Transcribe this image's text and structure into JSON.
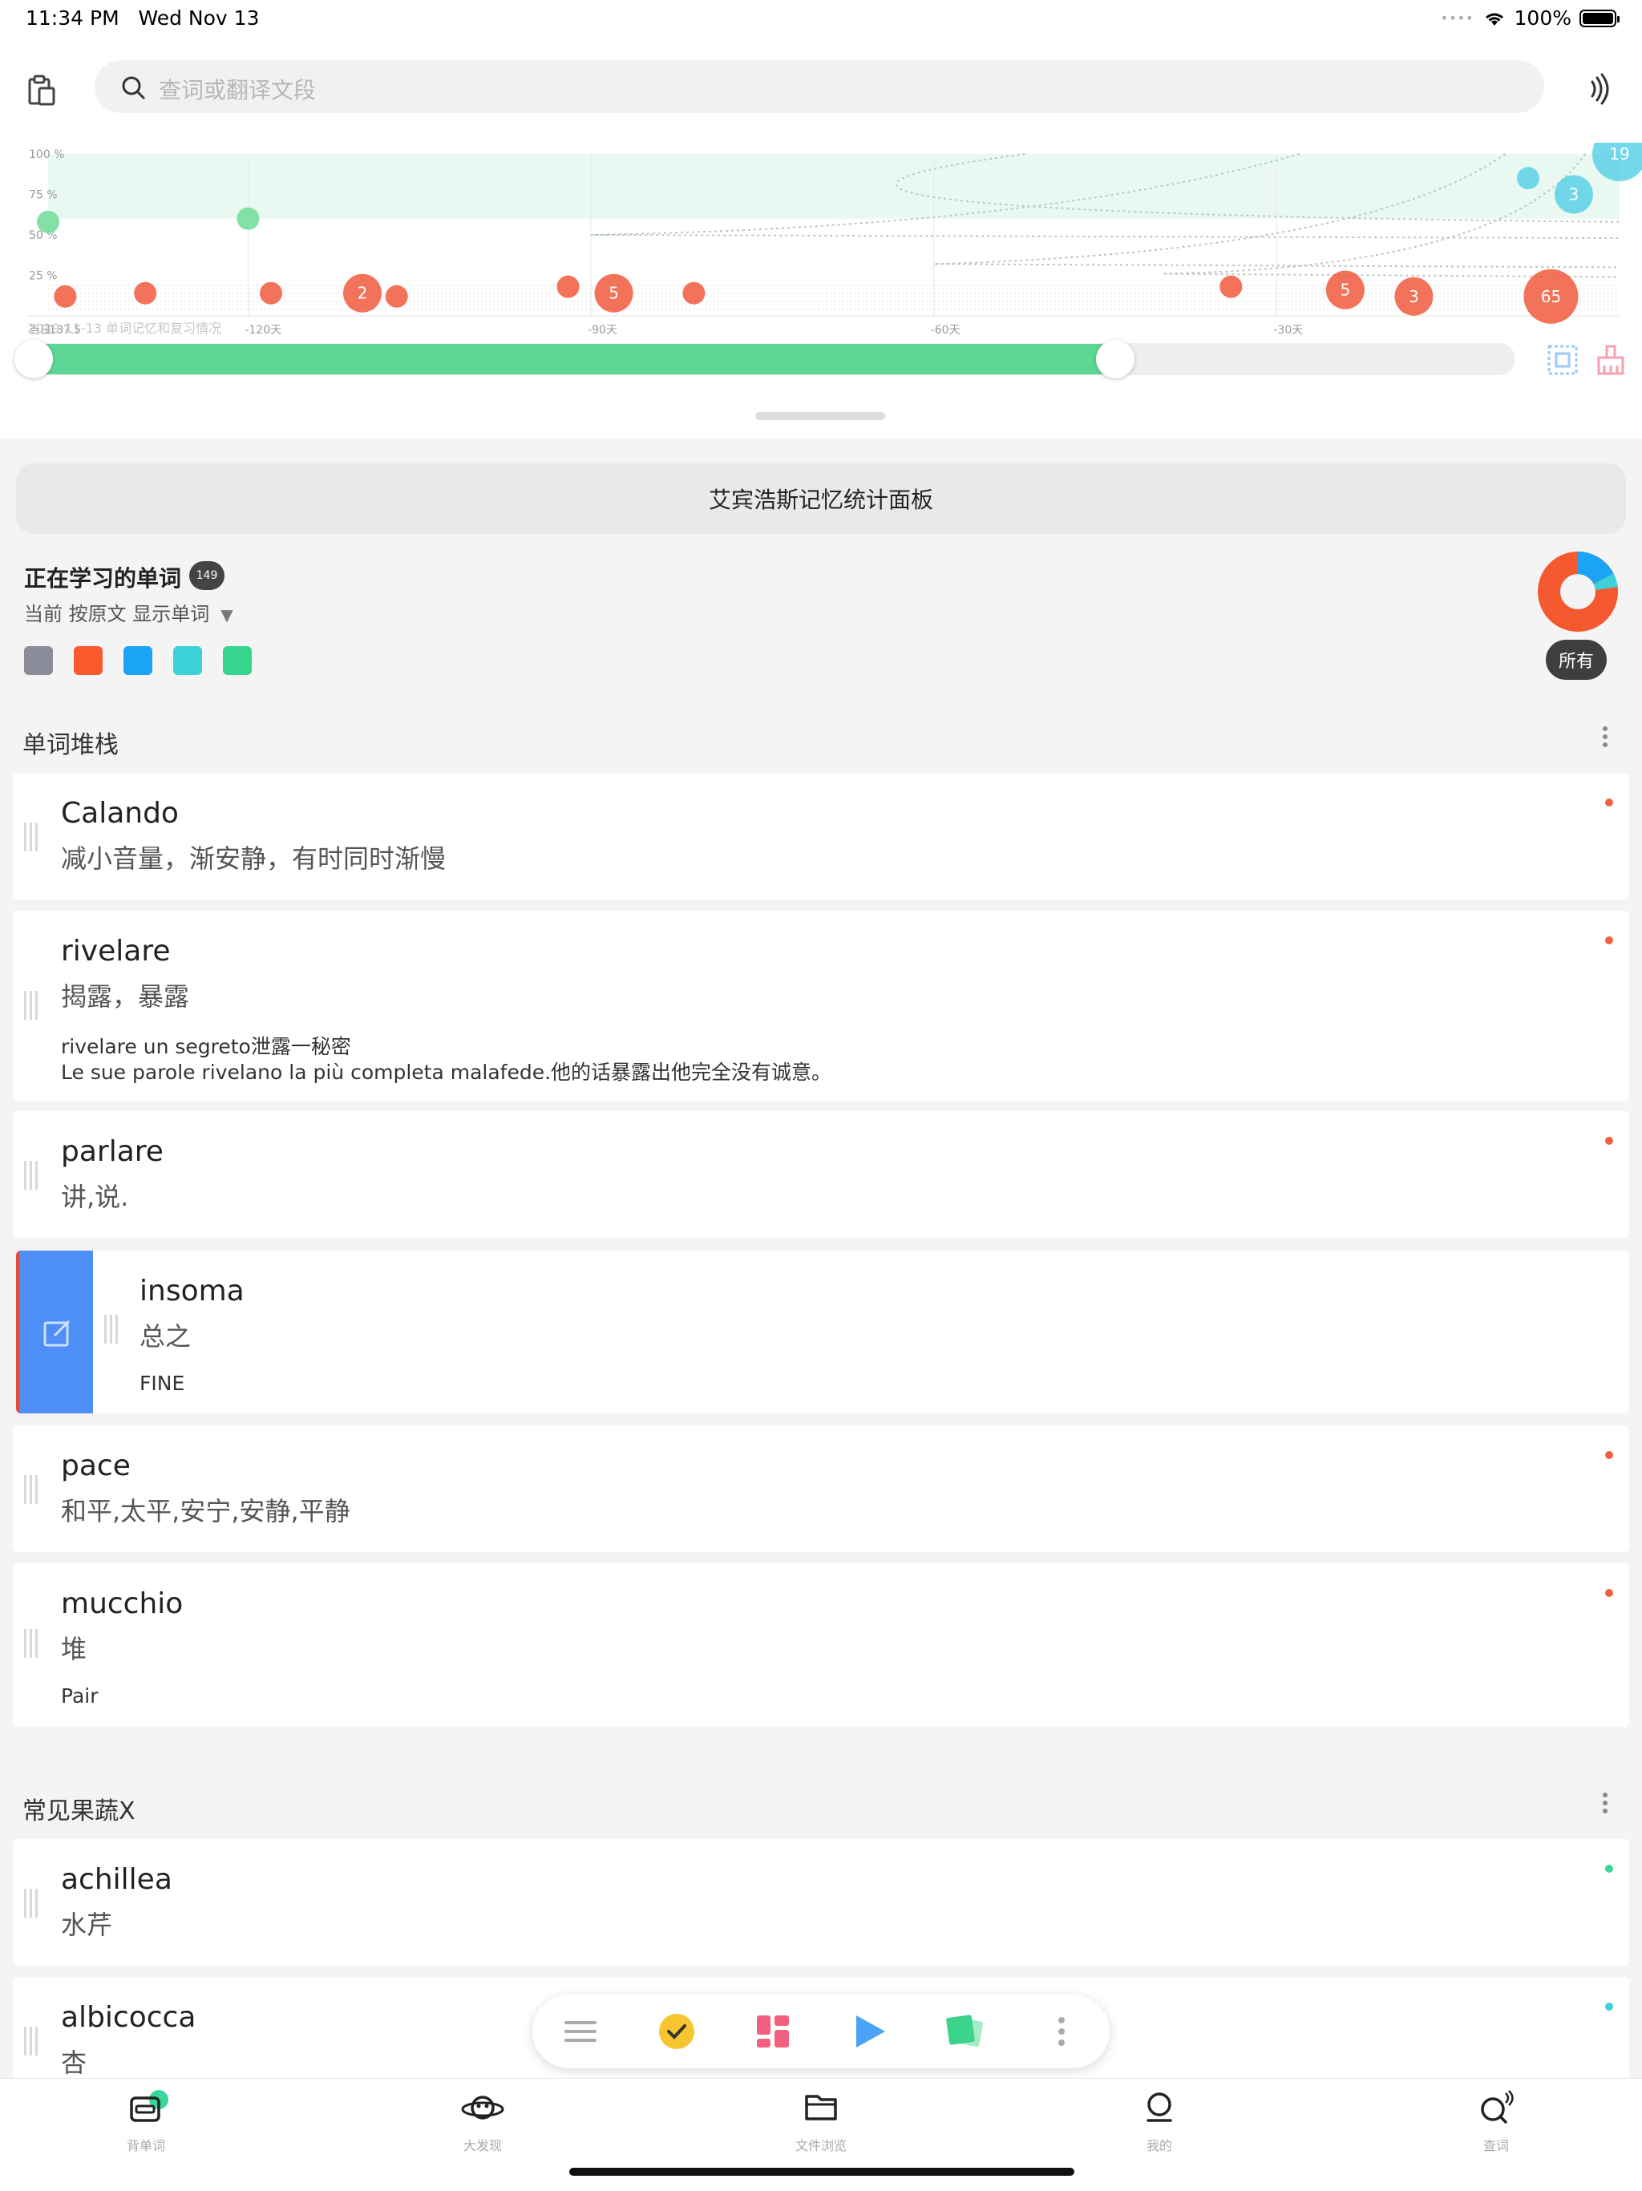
{
  "status_bar": {
    "time": "11:34 PM",
    "date": "Wed Nov 13",
    "battery": "100%"
  },
  "search": {
    "placeholder": "查词或翻译文段"
  },
  "chart_caption": "2019-11-13 单词记忆和复习情况",
  "chart_data": {
    "type": "scatter",
    "title": "",
    "xlabel": "",
    "ylabel": "",
    "y_ticks": [
      "25 %",
      "50 %",
      "75 %",
      "100 %"
    ],
    "x_ticks": [
      "当日",
      "-30天",
      "-60天",
      "-90天",
      "-120天",
      "-137.5"
    ],
    "xlim": [
      -137.5,
      0
    ],
    "ylim": [
      0,
      100
    ],
    "grid": true,
    "series": [
      {
        "color": "#5ad1e6",
        "points": [
          {
            "x": 0,
            "y": 100,
            "label": "19"
          },
          {
            "x": -4,
            "y": 75,
            "label": "3"
          },
          {
            "x": -8,
            "y": 85,
            "label": ""
          }
        ]
      },
      {
        "color": "#6ddc98",
        "points": [
          {
            "x": -120,
            "y": 60,
            "label": ""
          },
          {
            "x": -137.5,
            "y": 58,
            "label": ""
          }
        ]
      },
      {
        "color": "#f05a3c",
        "points": [
          {
            "x": -6,
            "y": 12,
            "label": "65"
          },
          {
            "x": -18,
            "y": 12,
            "label": "3"
          },
          {
            "x": -24,
            "y": 16,
            "label": "5"
          },
          {
            "x": -34,
            "y": 18,
            "label": ""
          },
          {
            "x": -81,
            "y": 14,
            "label": ""
          },
          {
            "x": -88,
            "y": 14,
            "label": "5"
          },
          {
            "x": -92,
            "y": 18,
            "label": ""
          },
          {
            "x": -107,
            "y": 12,
            "label": ""
          },
          {
            "x": -110,
            "y": 14,
            "label": "2"
          },
          {
            "x": -118,
            "y": 14,
            "label": ""
          },
          {
            "x": -129,
            "y": 14,
            "label": ""
          },
          {
            "x": -136,
            "y": 12,
            "label": ""
          }
        ]
      }
    ]
  },
  "slider": {
    "fill_fraction": 0.73
  },
  "stats_panel_label": "艾宾浩斯记忆统计面板",
  "learning": {
    "title": "正在学习的单词",
    "count": "149",
    "subtitle": "当前 按原文 显示单词",
    "all_label": "所有"
  },
  "swatch_colors": [
    "#8a8d99",
    "#f85a2e",
    "#1ba4f5",
    "#3cd1d9",
    "#36d58e"
  ],
  "sections": [
    {
      "title": "单词堆栈"
    },
    {
      "title": "常见果蔬X"
    }
  ],
  "cards": [
    {
      "word": "Calando",
      "meaning": "减小音量，渐安静，有时同时渐慢",
      "dot": "#f0623f"
    },
    {
      "word": "rivelare",
      "meaning": "揭露，暴露",
      "ex1": "rivelare un segreto泄露一秘密",
      "ex2": "Le sue parole rivelano la più completa malafede.他的话暴露出他完全没有诚意。",
      "dot": "#f0623f"
    },
    {
      "word": "parlare",
      "meaning": "讲,说.",
      "dot": "#f0623f"
    },
    {
      "word": "insoma",
      "meaning": "总之",
      "ex1": "FINE"
    },
    {
      "word": "pace",
      "meaning": "和平,太平,安宁,安静,平静",
      "dot": "#f0623f"
    },
    {
      "word": "mucchio",
      "meaning": "堆",
      "ex1": "Pair",
      "dot": "#f0623f"
    },
    {
      "word": "achillea",
      "meaning": "水芹",
      "dot": "#3ad69a"
    },
    {
      "word": "albicocca",
      "meaning": "杏",
      "dot": "#3cd1d9"
    }
  ],
  "tabs": [
    {
      "label": "背单词",
      "icon": "wallet-icon"
    },
    {
      "label": "大发现",
      "icon": "planet-icon"
    },
    {
      "label": "文件浏览",
      "icon": "folder-icon"
    },
    {
      "label": "我的",
      "icon": "person-icon"
    },
    {
      "label": "查词",
      "icon": "search-sound-icon"
    }
  ]
}
